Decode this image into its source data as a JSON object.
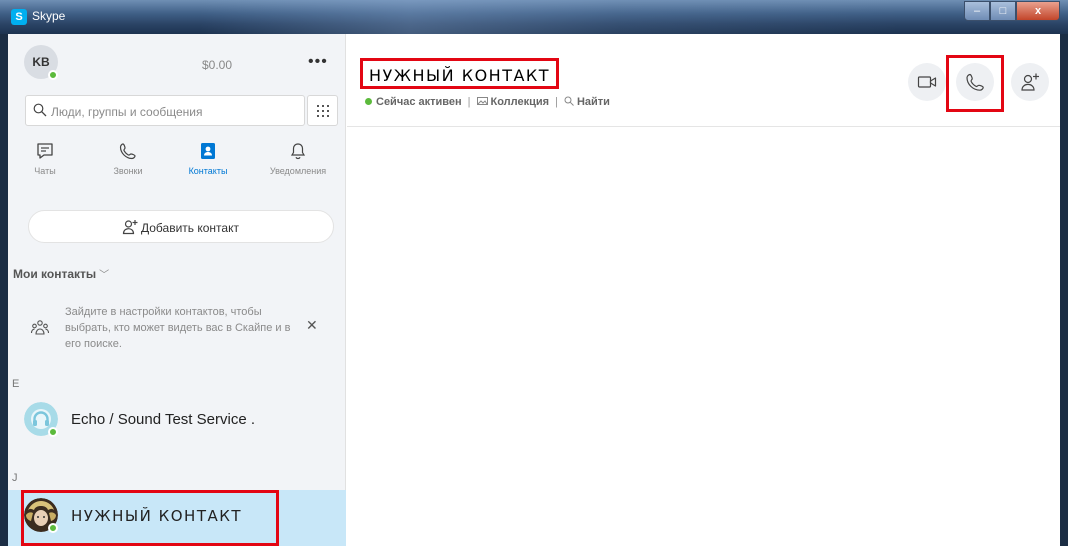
{
  "window": {
    "title": "Skype",
    "app_icon_letter": "S",
    "controls": {
      "minimize": "–",
      "maximize": "□",
      "close": "x"
    }
  },
  "profile": {
    "initials": "KB",
    "balance": "$0.00",
    "more": "•••"
  },
  "search": {
    "placeholder": "Люди, группы и сообщения"
  },
  "nav_tabs": [
    {
      "label": "Чаты",
      "icon": "chat-icon",
      "active": false
    },
    {
      "label": "Звонки",
      "icon": "phone-icon",
      "active": false
    },
    {
      "label": "Контакты",
      "icon": "contacts-icon",
      "active": true
    },
    {
      "label": "Уведомления",
      "icon": "bell-icon",
      "active": false
    }
  ],
  "add_contact": {
    "label": "Добавить контакт"
  },
  "contacts_section": {
    "heading": "Мои контакты",
    "hint": "Зайдите в настройки контактов, чтобы выбрать, кто может видеть вас в Скайпе и в его поиске.",
    "hint_close": "✕",
    "groups": [
      {
        "letter": "E",
        "contacts": [
          {
            "name": "Echo / Sound Test Service .",
            "online": true,
            "selected": false
          }
        ]
      },
      {
        "letter": "J",
        "contacts": [
          {
            "name": "НУЖНЫЙ КОНТАКТ",
            "online": true,
            "selected": true
          }
        ]
      }
    ]
  },
  "conversation": {
    "title": "НУЖНЫЙ КОНТАКТ",
    "status": "Сейчас активен",
    "gallery_label": "Коллекция",
    "find_label": "Найти",
    "separator": "|",
    "actions": [
      {
        "name": "video-call",
        "icon": "video-icon"
      },
      {
        "name": "audio-call",
        "icon": "phone-icon"
      },
      {
        "name": "add-people",
        "icon": "add-person-icon"
      }
    ]
  },
  "colors": {
    "accent": "#0078d4",
    "online": "#5cba3c",
    "highlight_annotation": "#e30613",
    "selected_row": "#c8e7f8"
  }
}
